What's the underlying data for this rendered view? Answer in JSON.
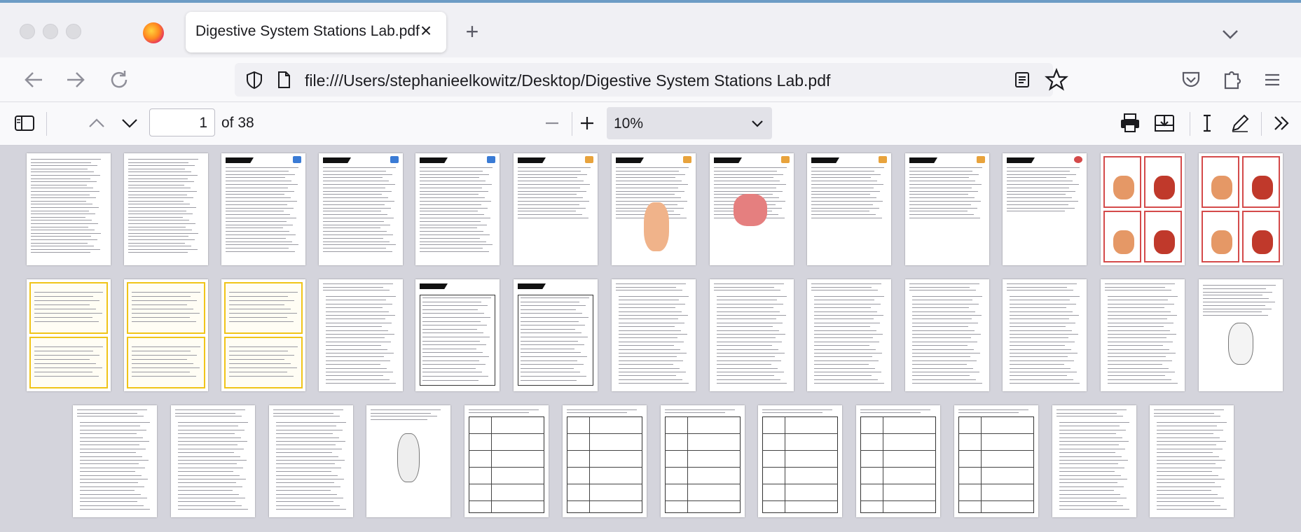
{
  "browser": {
    "tab": {
      "title": "Digestive System Stations Lab.pdf"
    },
    "url": "file:///Users/stephanieelkowitz/Desktop/Digestive System Stations Lab.pdf"
  },
  "pdf_toolbar": {
    "current_page": "1",
    "page_count_label": "of 38",
    "zoom": "10%"
  },
  "icons": {
    "sidebar": "sidebar-toggle-icon",
    "prev": "chevron-up-icon",
    "next": "chevron-down-icon",
    "zoom_out": "minus-icon",
    "zoom_in": "plus-icon",
    "print": "printer-icon",
    "save": "download-icon",
    "text": "text-cursor-icon",
    "draw": "pen-icon",
    "more": "double-chevron-icon"
  },
  "colors": {
    "accent_blue": "#0060df",
    "card_yellow": "#f0c419",
    "question_red": "#d44a4a",
    "station_tag_orange": "#e8a33c"
  }
}
